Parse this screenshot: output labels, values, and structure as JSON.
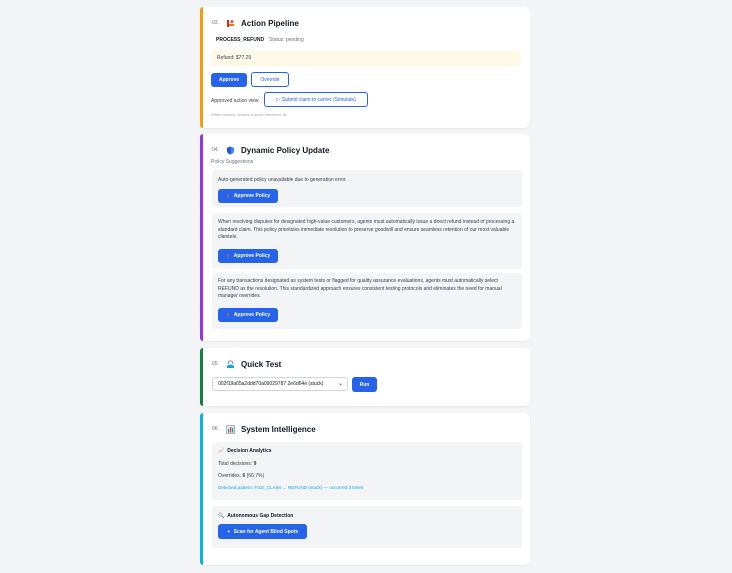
{
  "action_pipeline": {
    "number": "03.",
    "title": "Action Pipeline",
    "action_name": "PROCESS_REFUND",
    "status": "Status: pending",
    "refund_text": "Refund: $77.29",
    "approve_label": "Approve",
    "override_label": "Override",
    "approved_action_label": "Approved action view",
    "submit_claim_label": "Submit claim to carrier (Simulate)",
    "hint": "When clicked, returns a mock reference ID.",
    "accent_color": "#f59e0b"
  },
  "policy_update": {
    "number": "04.",
    "title": "Dynamic Policy Update",
    "subtitle": "Policy Suggestions",
    "accent_color": "#9333ea",
    "suggestions": [
      {
        "text": "Auto-generated policy unavailable due to generation error.",
        "button_label": "Approve Policy"
      },
      {
        "text": "When resolving disputes for designated high-value customers, agents must automatically issue a direct refund instead of processing a standard claim. This policy prioritizes immediate resolution to preserve goodwill and ensure seamless retention of our most valuable clientele.",
        "button_label": "Approve Policy"
      },
      {
        "text": "For any transactions designated as system tests or flagged for quality assurance evaluations, agents must automatically select REFUND as the resolution. This standardized approach ensures consistent testing protocols and eliminates the need for manual manager overrides.",
        "button_label": "Approve Policy"
      }
    ]
  },
  "quick_test": {
    "number": "05.",
    "title": "Quick Test",
    "select_value": "002f19a65a2ddd70a09029787 2e6d64e (stuck)",
    "run_label": "Run",
    "accent_color": "#15803d"
  },
  "system_intelligence": {
    "number": "06.",
    "title": "System Intelligence",
    "accent_color": "#06b6d4",
    "analytics_title": "Decision Analytics",
    "total_decisions_label": "Total decisions:",
    "total_decisions_value": "9",
    "overrides_label": "Overrides:",
    "overrides_value": "6",
    "overrides_pct": "(66.7%)",
    "pattern_text": "Detected pattern: FILE_CLAIM → REFUND (stuck) — occurred 3 times",
    "gap_title": "Autonomous Gap Detection",
    "scan_label": "Scan for Agent Blind Spots"
  }
}
